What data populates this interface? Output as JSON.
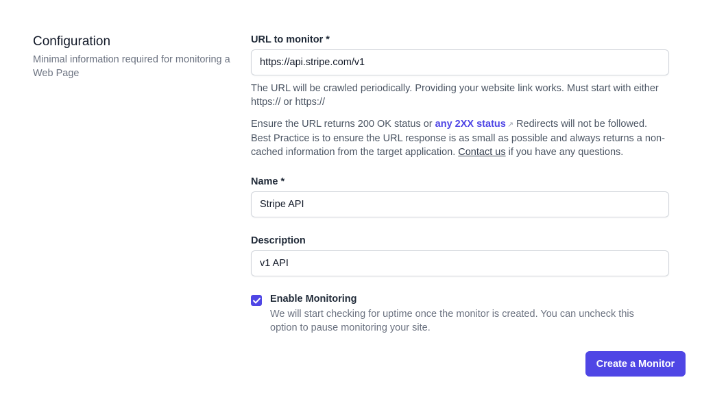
{
  "section": {
    "title": "Configuration",
    "description": "Minimal information required for monitoring a Web Page"
  },
  "url_field": {
    "label": "URL to monitor *",
    "value": "https://api.stripe.com/v1",
    "help": "The URL will be crawled periodically. Providing your website link works. Must start with either https:// or https://",
    "note_before_link": "Ensure the URL returns 200 OK status or",
    "note_link": "any 2XX status",
    "external_icon": "external-link-icon",
    "note_after_link": "Redirects will not be followed. Best Practice is to ensure the URL response is as small as possible and always returns a non-cached information from the target application.",
    "contact_link": "Contact us",
    "note_end": "if you have any questions."
  },
  "name_field": {
    "label": "Name *",
    "value": "Stripe API"
  },
  "description_field": {
    "label": "Description",
    "value": "v1 API"
  },
  "enable_monitoring": {
    "checked": true,
    "label": "Enable Monitoring",
    "help": "We will start checking for uptime once the monitor is created. You can uncheck this option to pause monitoring your site."
  },
  "submit": {
    "label": "Create a Monitor"
  },
  "colors": {
    "accent": "#4f46e5",
    "text": "#111827",
    "muted": "#6b7280",
    "border": "#d1d5db"
  }
}
